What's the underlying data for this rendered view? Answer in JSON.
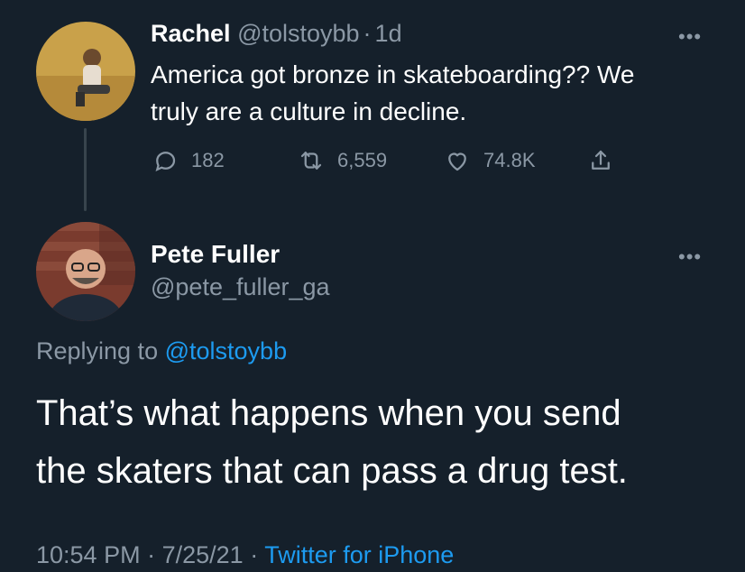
{
  "original": {
    "name": "Rachel",
    "handle": "@tolstoybb",
    "separator": "·",
    "age": "1d",
    "text_line1": "America got bronze in skateboarding?? We",
    "text_line2": "truly are a culture in decline.",
    "actions": {
      "reply_count": "182",
      "retweet_count": "6,559",
      "like_count": "74.8K"
    },
    "more": "•••"
  },
  "reply": {
    "name": "Pete Fuller",
    "handle": "@pete_fuller_ga",
    "more": "•••",
    "replying_prefix": "Replying to",
    "replying_handle": "@tolstoybb",
    "text_line1": "That’s what happens when you send",
    "text_line2": "the skaters that can pass a drug test.",
    "time": "10:54 PM",
    "date": "7/25/21",
    "dot": "·",
    "source": "Twitter for iPhone"
  },
  "colors": {
    "background": "#15202b",
    "muted": "#8b98a5",
    "link": "#1d9bf0",
    "thread_line": "#38444d"
  },
  "icons": [
    "reply-icon",
    "retweet-icon",
    "like-icon",
    "share-icon",
    "more-icon"
  ]
}
